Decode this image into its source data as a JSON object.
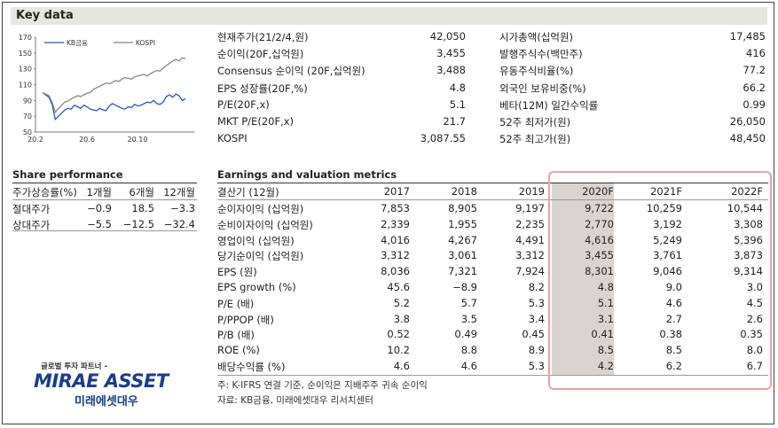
{
  "key_data": {
    "title": "Key data",
    "left": [
      {
        "label": "현재주가(21/2/4,원)",
        "value": "42,050"
      },
      {
        "label": "순이익(20F,십억원)",
        "value": "3,455"
      },
      {
        "label": "Consensus 순이익 (20F,십억원)",
        "value": "3,488"
      },
      {
        "label": "EPS 성장률(20F,%)",
        "value": "4.8"
      },
      {
        "label": "P/E(20F,x)",
        "value": "5.1"
      },
      {
        "label": "MKT P/E(20F,x)",
        "value": "21.7"
      },
      {
        "label": "KOSPI",
        "value": "3,087.55"
      }
    ],
    "right": [
      {
        "label": "시가총액(십억원)",
        "value": "17,485"
      },
      {
        "label": "발행주식수(백만주)",
        "value": "416"
      },
      {
        "label": "유동주식비율(%)",
        "value": "77.2"
      },
      {
        "label": "외국인 보유비중(%)",
        "value": "66.2"
      },
      {
        "label": "베타(12M) 일간수익률",
        "value": "0.99"
      },
      {
        "label": "52주 최저가(원)",
        "value": "26,050"
      },
      {
        "label": "52주 최고가(원)",
        "value": "48,450"
      }
    ]
  },
  "chart_data": {
    "type": "line",
    "x_ticks": [
      "20.2",
      "20.6",
      "20.10"
    ],
    "y_ticks": [
      50,
      70,
      90,
      110,
      130,
      150,
      170
    ],
    "ylim": [
      50,
      170
    ],
    "legend_position": "top-left",
    "series": [
      {
        "name": "KB금융",
        "color": "#2457c5",
        "values": [
          100,
          97,
          94,
          85,
          66,
          70,
          74,
          78,
          80,
          79,
          84,
          82,
          80,
          84,
          82,
          79,
          78,
          77,
          80,
          78,
          77,
          83,
          86,
          84,
          82,
          80,
          79,
          82,
          81,
          85,
          83,
          84,
          86,
          88,
          87,
          90,
          86,
          85,
          88,
          95,
          97,
          94,
          98,
          96,
          90,
          92
        ]
      },
      {
        "name": "KOSPI",
        "color": "#888888",
        "values": [
          100,
          98,
          96,
          88,
          75,
          80,
          84,
          88,
          89,
          92,
          94,
          96,
          95,
          97,
          99,
          100,
          104,
          106,
          108,
          110,
          112,
          111,
          113,
          115,
          114,
          117,
          119,
          118,
          117,
          120,
          121,
          122,
          123,
          121,
          124,
          126,
          128,
          127,
          131,
          134,
          137,
          140,
          142,
          140,
          144,
          143
        ]
      }
    ]
  },
  "share_perf": {
    "title": "Share performance",
    "headers": [
      "주가상승률(%)",
      "1개월",
      "6개월",
      "12개월"
    ],
    "rows": [
      [
        "절대주가",
        "−0.9",
        "18.5",
        "−3.3"
      ],
      [
        "상대주가",
        "−5.5",
        "−12.5",
        "−32.4"
      ]
    ]
  },
  "earnings": {
    "title": "Earnings and valuation metrics",
    "headers": [
      "결산기 (12월)",
      "2017",
      "2018",
      "2019",
      "2020F",
      "2021F",
      "2022F"
    ],
    "rows": [
      [
        "순이자이익 (십억원)",
        "7,853",
        "8,905",
        "9,197",
        "9,722",
        "10,259",
        "10,544"
      ],
      [
        "순비이자이익 (십억원)",
        "2,339",
        "1,955",
        "2,235",
        "2,770",
        "3,192",
        "3,308"
      ],
      [
        "영업이익 (십억원)",
        "4,016",
        "4,267",
        "4,491",
        "4,616",
        "5,249",
        "5,396"
      ],
      [
        "당기순이익 (십억원)",
        "3,312",
        "3,061",
        "3,312",
        "3,455",
        "3,761",
        "3,873"
      ],
      [
        "EPS (원)",
        "8,036",
        "7,321",
        "7,924",
        "8,301",
        "9,046",
        "9,314"
      ],
      [
        "EPS growth (%)",
        "45.6",
        "−8.9",
        "8.2",
        "4.8",
        "9.0",
        "3.0"
      ],
      [
        "P/E (배)",
        "5.2",
        "5.7",
        "5.3",
        "5.1",
        "4.6",
        "4.5"
      ],
      [
        "P/PPOP (배)",
        "3.8",
        "3.5",
        "3.4",
        "3.1",
        "2.7",
        "2.6"
      ],
      [
        "P/B (배)",
        "0.52",
        "0.49",
        "0.45",
        "0.41",
        "0.38",
        "0.35"
      ],
      [
        "ROE (%)",
        "10.2",
        "8.8",
        "8.9",
        "8.5",
        "8.5",
        "8.0"
      ],
      [
        "배당수익률 (%)",
        "4.6",
        "4.6",
        "5.3",
        "4.2",
        "6.2",
        "6.7"
      ]
    ],
    "notes": [
      "주: K-IFRS 연결 기준, 순이익은 지배주주 귀속 순이익",
      "자료: KB금융, 미래에셋대우 리서치센터"
    ]
  },
  "logo": {
    "tagline": "글로벌 투자 파트너 -",
    "brand": "MIRAE ASSET",
    "brand_kr": "미래에셋대우",
    "brand_color": "#1a3c8c"
  }
}
